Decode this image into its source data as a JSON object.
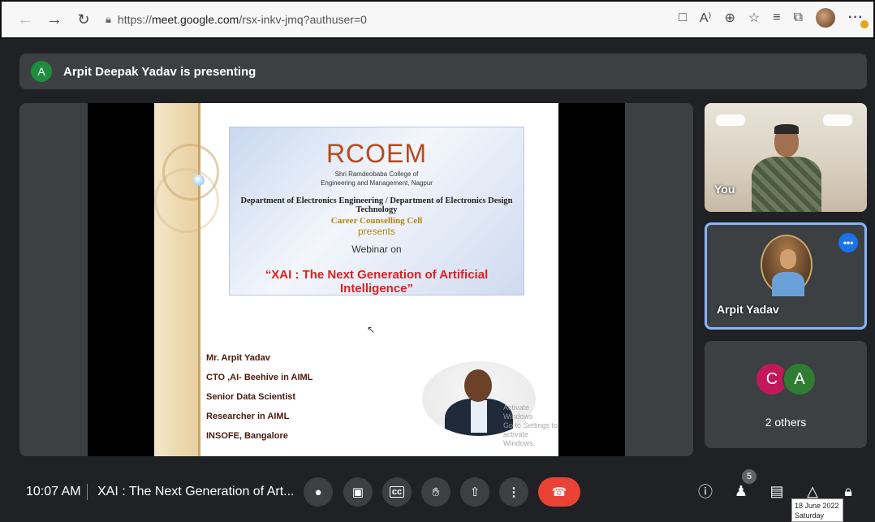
{
  "browser": {
    "url_prefix": "https://",
    "url_host": "meet.google.com",
    "url_path": "/rsx-inkv-jmq?authuser=0",
    "icons": [
      "back-icon",
      "forward-icon",
      "reload-icon",
      "site-info-icon",
      "camera-icon",
      "read-aloud-icon",
      "zoom-icon",
      "favorite-icon",
      "favorites-bar-icon",
      "collections-icon",
      "profile-avatar",
      "more-icon"
    ]
  },
  "banner": {
    "avatar_letter": "A",
    "text": "Arpit Deepak Yadav is presenting"
  },
  "slide": {
    "logo": "RCOEM",
    "college_line1": "Shri Ramdeobaba College of",
    "college_line2": "Engineering and Management, Nagpur",
    "department": "Department of Electronics Engineering / Department of Electronics Design Technology",
    "cell": "Career Counselling Cell",
    "presents": "presents",
    "webinar": "Webinar on",
    "title": "“XAI : The Next Generation of Artificial Intelligence”",
    "speaker_lines": [
      "Mr. Arpit Yadav",
      "CTO ,AI- Beehive in AIML",
      "Senior Data  Scientist",
      "Researcher in AIML",
      "INSOFE, Bangalore"
    ],
    "watermark_line1": "Activate Windows",
    "watermark_line2": "Go to Settings to activate Windows."
  },
  "participants": {
    "you_label": "You",
    "arpit_label": "Arpit Yadav",
    "more_label": "•••",
    "others_avatars": [
      "C",
      "A"
    ],
    "others_label": "2 others"
  },
  "bottom": {
    "time": "10:07 AM",
    "meeting_title": "XAI : The Next Generation of Art...",
    "people_count": "5"
  },
  "taskbar_tooltip": {
    "date": "18 June 2022",
    "day": "Saturday"
  },
  "colors": {
    "meet_bg": "#202124",
    "tile_bg": "#3c4043",
    "end_call": "#ea4335",
    "active_border": "#8ab4f8",
    "title_red": "#e02020",
    "logo_orange": "#b84a1a"
  }
}
